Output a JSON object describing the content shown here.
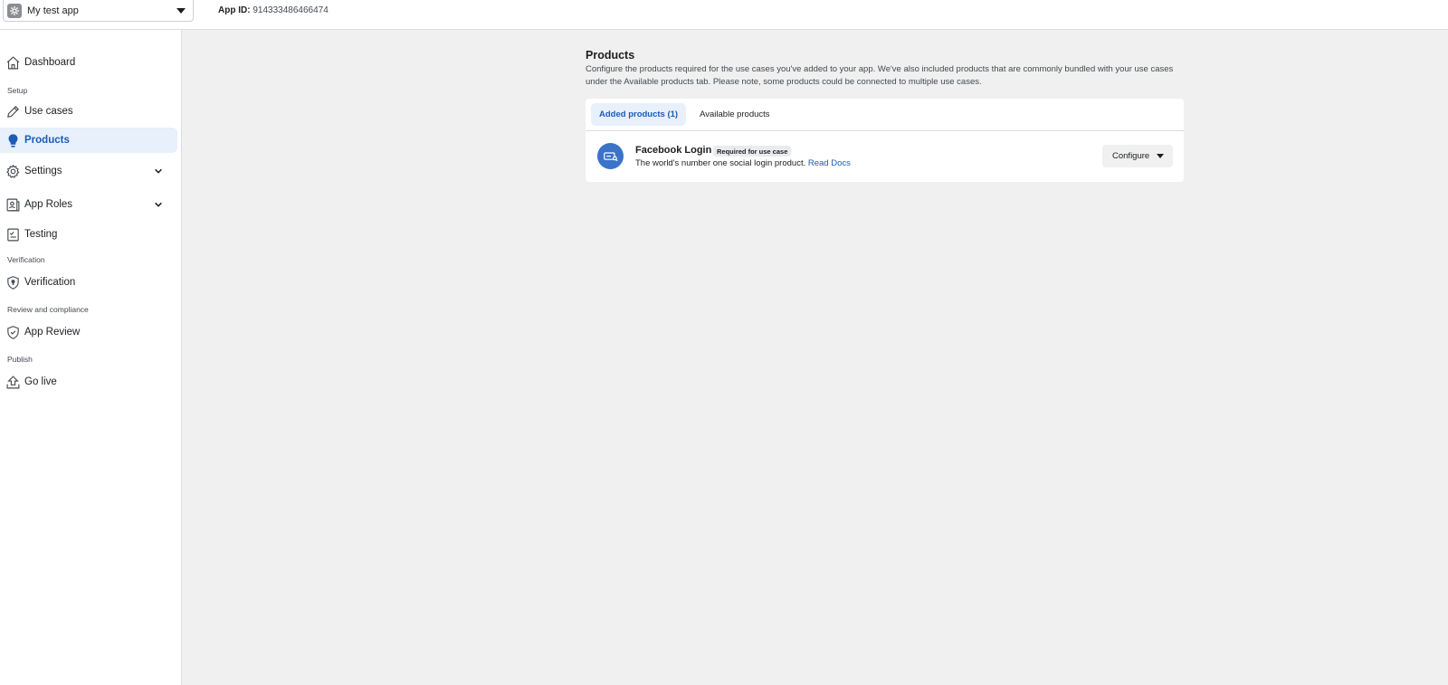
{
  "topbar": {
    "app_name": "My test app",
    "app_id_label": "App ID:",
    "app_id_value": "914333486466474"
  },
  "sidebar": {
    "items": [
      {
        "label": "Dashboard",
        "icon": "home-icon"
      },
      {
        "section": "Setup"
      },
      {
        "label": "Use cases",
        "icon": "pencil-icon"
      },
      {
        "label": "Products",
        "icon": "lightbulb-icon",
        "active": true
      },
      {
        "label": "Settings",
        "icon": "gear-icon",
        "expandable": true
      },
      {
        "label": "App Roles",
        "icon": "id-badge-icon",
        "expandable": true
      },
      {
        "label": "Testing",
        "icon": "checklist-icon"
      },
      {
        "section": "Verification"
      },
      {
        "label": "Verification",
        "icon": "shield-icon"
      },
      {
        "section": "Review and compliance"
      },
      {
        "label": "App Review",
        "icon": "shield-check-icon"
      },
      {
        "section": "Publish"
      },
      {
        "label": "Go live",
        "icon": "upload-arrow-icon"
      }
    ]
  },
  "main": {
    "title": "Products",
    "description": "Configure the products required for the use cases you've added to your app. We've also included products that are commonly bundled with your use cases under the Available products tab. Please note, some products could be connected to multiple use cases.",
    "tabs": [
      {
        "label": "Added products (1)",
        "active": true
      },
      {
        "label": "Available products",
        "active": false
      }
    ],
    "products": [
      {
        "name": "Facebook Login",
        "badge": "Required for use case",
        "description": "The world's number one social login product.",
        "docs_link": "Read Docs",
        "action": "Configure",
        "icon": "login-card-icon"
      }
    ]
  },
  "colors": {
    "accent": "#1d5bb4",
    "active_bg": "#e7f0fb",
    "product_icon_bg": "#3b73c8",
    "page_bg": "#f0f0f0"
  }
}
